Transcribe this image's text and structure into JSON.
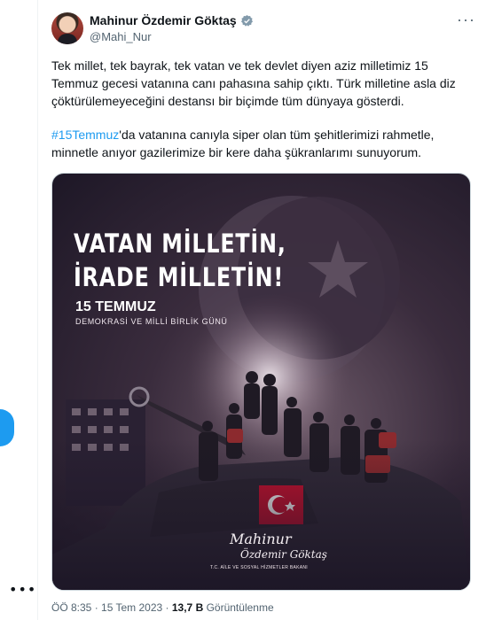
{
  "author": {
    "display_name": "Mahinur Özdemir Göktaş",
    "handle": "@Mahi_Nur",
    "verified_color": "#829aab"
  },
  "tweet": {
    "paragraph1": "Tek millet, tek bayrak, tek vatan ve tek devlet diyen aziz milletimiz 15 Temmuz gecesi vatanına canı pahasına sahip çıktı. Türk milletine asla diz çöktürülemeyeceğini destansı bir biçimde tüm dünyaya gösterdi.",
    "hashtag": "#15Temmuz",
    "paragraph2_rest": "'da vatanına canıyla siper olan tüm şehitlerimizi rahmetle, minnetle anıyor gazilerimize bir kere daha şükranlarımı sunuyorum."
  },
  "media": {
    "headline_line1": "VATAN MİLLETİN,",
    "headline_line2": "İRADE MİLLETİN!",
    "date_title": "15 TEMMUZ",
    "date_subtitle": "DEMOKRASİ VE MİLLİ BİRLİK GÜNÜ",
    "signature_line1": "Mahinur",
    "signature_line2": "Özdemir Göktaş",
    "signature_title": "T.C. AİLE VE SOSYAL HİZMETLER BAKANI"
  },
  "meta": {
    "time": "ÖÖ 8:35",
    "date": "15 Tem 2023",
    "views_count": "13,7 B",
    "views_label": "Görüntülenme"
  },
  "colors": {
    "link": "#1d9bf0",
    "text": "#0f1419",
    "secondary": "#536471"
  }
}
